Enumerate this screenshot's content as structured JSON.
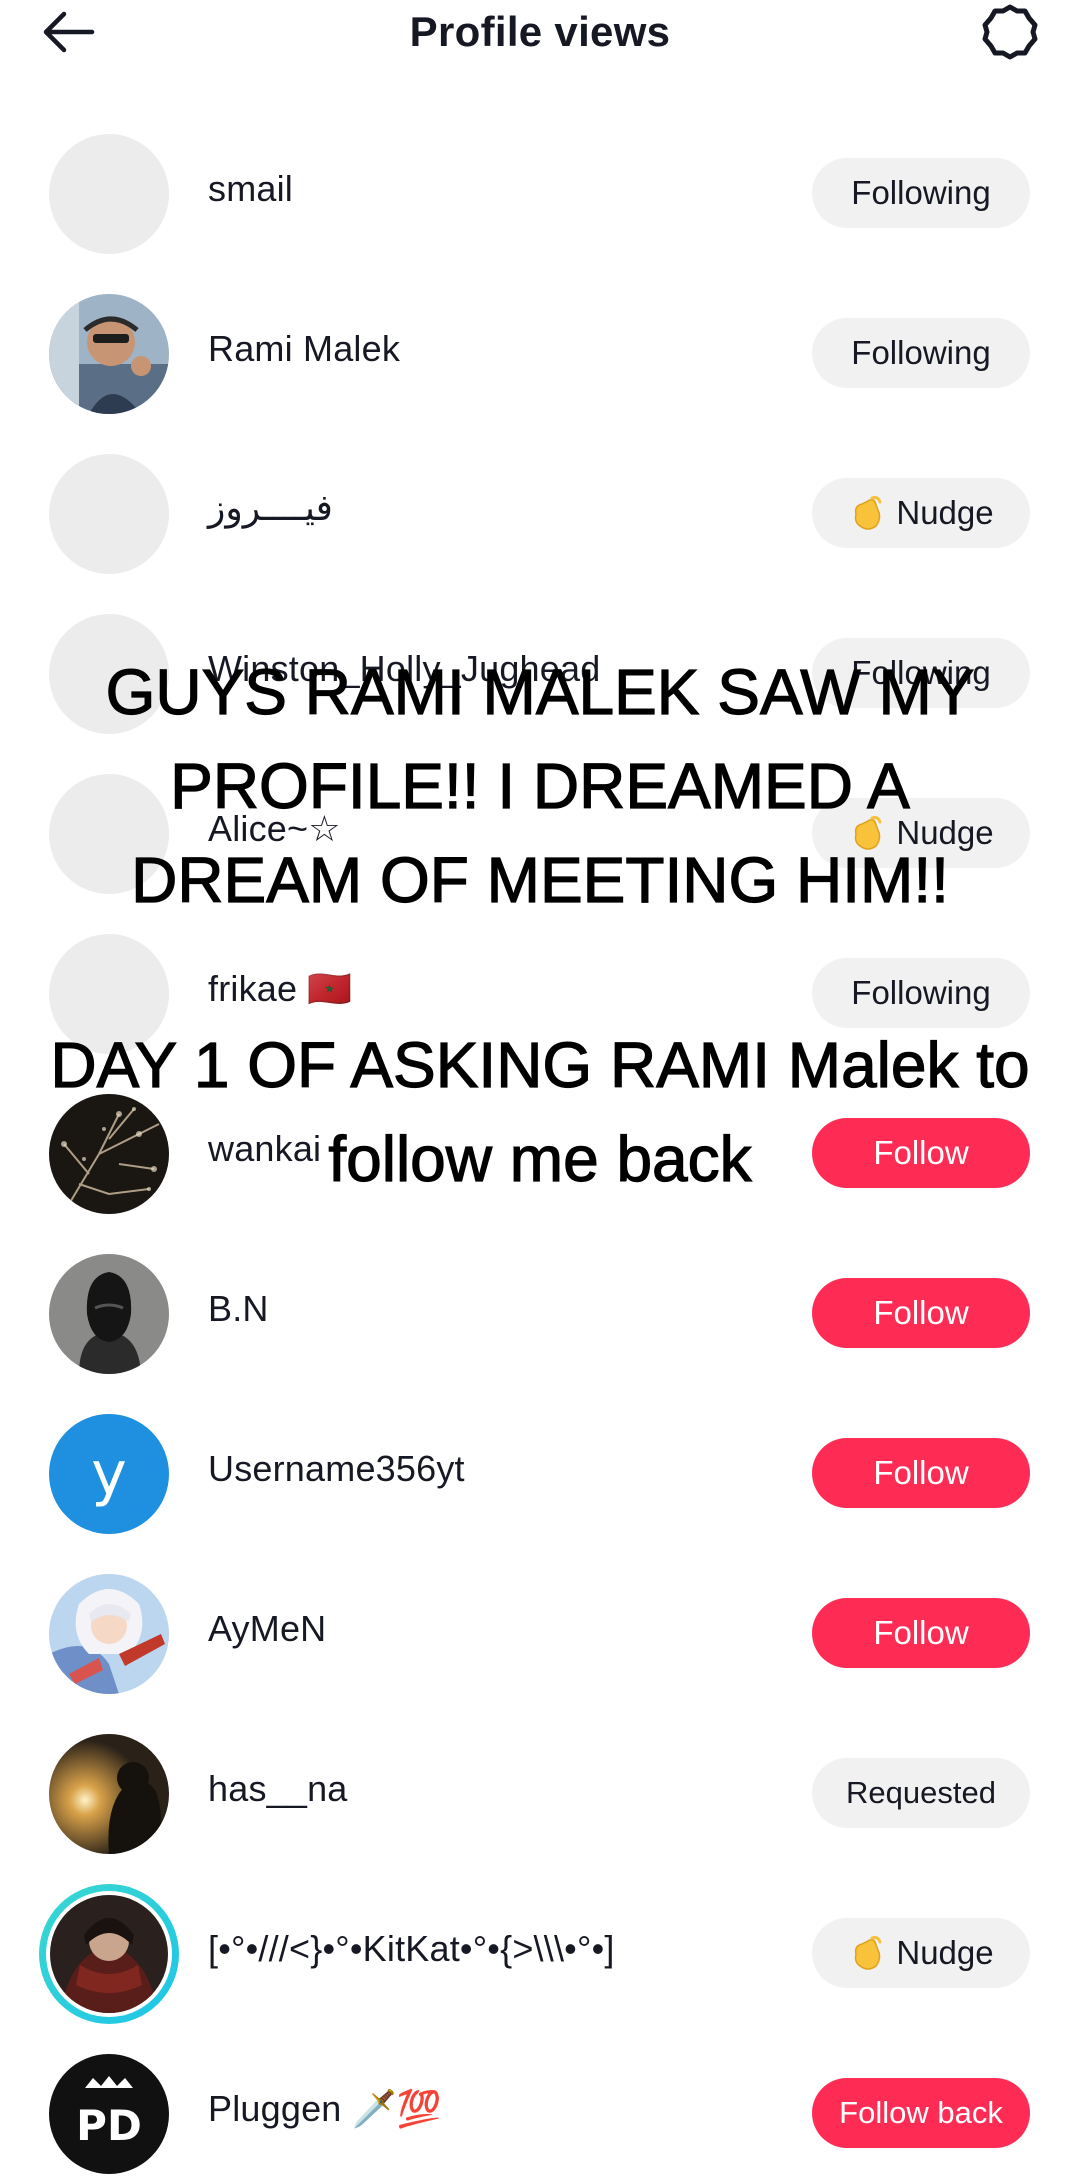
{
  "header": {
    "title": "Profile views"
  },
  "rows": [
    {
      "username": "smail",
      "action": "Following"
    },
    {
      "username": "Rami Malek",
      "action": "Following"
    },
    {
      "username": "فيــــروز",
      "action": "Nudge"
    },
    {
      "username": "Winston_Holly_Jughead",
      "action": "Following"
    },
    {
      "username": "Alice~☆",
      "action": "Nudge"
    },
    {
      "username": "frikae 🇲🇦",
      "action": "Following"
    },
    {
      "username": "wankai",
      "action": "Follow"
    },
    {
      "username": "B.N",
      "action": "Follow"
    },
    {
      "username": "Username356yt",
      "action": "Follow",
      "avatar_letter": "y"
    },
    {
      "username": "AyMeN",
      "action": "Follow"
    },
    {
      "username": "has__na",
      "action": "Requested"
    },
    {
      "username": "[•°•///<}•°•KitKat•°•{>\\\\\\•°•]",
      "action": "Nudge"
    },
    {
      "username": "Pluggen 🗡️💯",
      "action": "Follow back"
    }
  ],
  "overlay": {
    "caption_1": "GUYS RAMI MALEK SAW MY PROFILE!! I DREAMED A DREAM OF MEETING HIM!!",
    "caption_2": "DAY 1 OF ASKING RAMI Malek to follow me back"
  },
  "colors": {
    "follow_red": "#fe2c55",
    "button_gray": "#f1f1f2",
    "story_ring": "#22cde0",
    "letter_avatar": "#1f8fe0"
  }
}
